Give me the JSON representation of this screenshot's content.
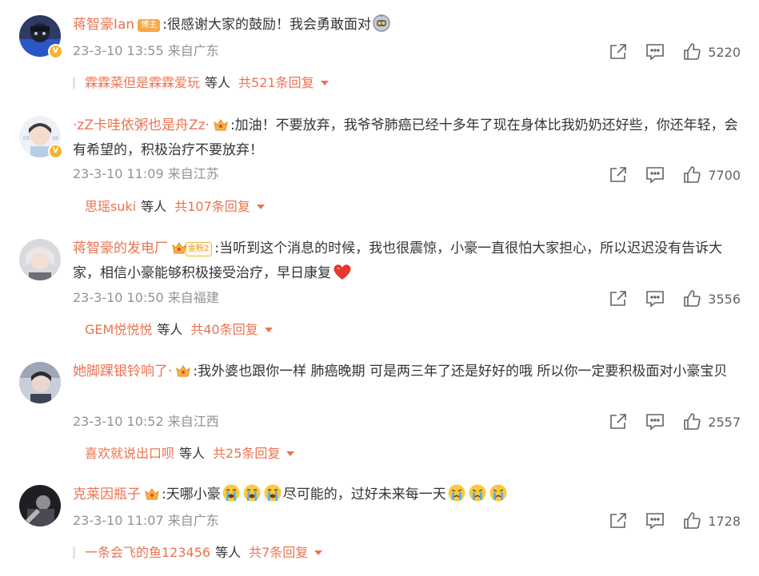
{
  "comments": [
    {
      "username": "蒋智豪Ian",
      "tag": "博主",
      "text_parts": [
        ":很感谢大家的鼓励！我会勇敢面对"
      ],
      "emoji": "robot-emoji",
      "time": "23-3-10 13:55",
      "location": "来自广东",
      "likes": "5220",
      "reply_user": "霖霖菜但是霖霖爱玩",
      "reply_suffix": "等人",
      "reply_count": "共521条回复"
    },
    {
      "username": "·zZ卡哇依粥也是舟Zz·",
      "text": ":加油！不要放弃，我爷爷肺癌已经十多年了现在身体比我奶奶还好些，你还年轻，会有希望的，积极治疗不要放弃！",
      "time": "23-3-10 11:09",
      "location": "来自江苏",
      "likes": "7700",
      "reply_user": "思瑶suki",
      "reply_suffix": "等人",
      "reply_count": "共107条回复"
    },
    {
      "username": "蒋智豪的发电厂",
      "fan_badge": "金粉2",
      "text": ":当听到这个消息的时候，我也很震惊，小豪一直很怕大家担心，所以迟迟没有告诉大家，相信小豪能够积极接受治疗，早日康复",
      "time": "23-3-10 10:50",
      "location": "来自福建",
      "likes": "3556",
      "reply_user": "GEM悦悦悦",
      "reply_suffix": "等人",
      "reply_count": "共40条回复"
    },
    {
      "username": "她脚踝银铃响了·",
      "text": ":我外婆也跟你一样 肺癌晚期 可是两三年了还是好好的哦 所以你一定要积极面对小豪宝贝",
      "time": "23-3-10 10:52",
      "location": "来自江西",
      "likes": "2557",
      "reply_user": "喜欢就说出口呗",
      "reply_suffix": "等人",
      "reply_count": "共25条回复"
    },
    {
      "username": "克莱因瓶子",
      "text_a": ":天哪小豪",
      "text_b": "尽可能的，过好未来每一天",
      "time": "23-3-10 11:07",
      "location": "来自广东",
      "likes": "1728",
      "reply_user": "一条会飞的鱼123456",
      "reply_suffix": "等人",
      "reply_count": "共7条回复"
    }
  ],
  "verified_mark": "V",
  "colors": {
    "username": "#eb7350",
    "meta": "#939393",
    "icon": "#636363"
  },
  "icons": {
    "share": "share-icon",
    "comment": "comment-icon",
    "like": "like-icon",
    "expand": "chevron-down-icon"
  }
}
